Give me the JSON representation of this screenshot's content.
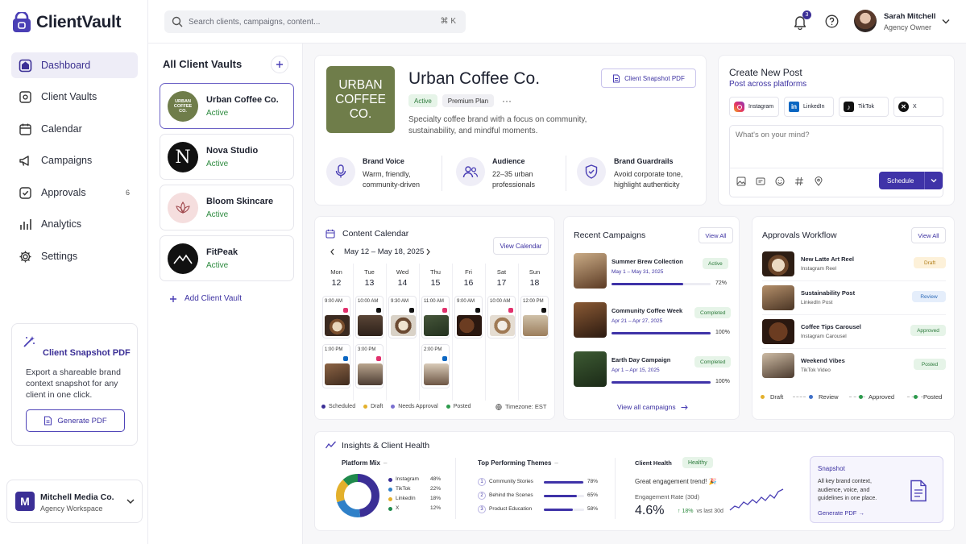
{
  "app": {
    "name": "ClientVault",
    "accent": "#4a3fb5"
  },
  "sidebar": {
    "items": [
      {
        "label": "Dashboard",
        "icon": "dashboard-icon"
      },
      {
        "label": "Client Vaults",
        "icon": "vault-icon"
      },
      {
        "label": "Calendar",
        "icon": "calendar-icon"
      },
      {
        "label": "Campaigns",
        "icon": "megaphone-icon"
      },
      {
        "label": "Approvals",
        "icon": "check-square-icon",
        "count": "6"
      },
      {
        "label": "Analytics",
        "icon": "bar-chart-icon"
      },
      {
        "label": "Settings",
        "icon": "gear-icon"
      }
    ],
    "snapshot_card": {
      "title": "Client Snapshot PDF",
      "description": "Export a shareable brand context snapshot for any client in one click.",
      "button": "Generate PDF"
    },
    "workspace": {
      "initial": "M",
      "name": "Mitchell Media Co.",
      "subtitle": "Agency Workspace"
    }
  },
  "topbar": {
    "search_placeholder": "Search clients, campaigns, content...",
    "shortcut": "⌘ K",
    "notification_count": "3",
    "user": {
      "name": "Sarah Mitchell",
      "role": "Agency Owner"
    }
  },
  "vaults": {
    "title": "All Client Vaults",
    "add_label": "Add Client Vault",
    "items": [
      {
        "name": "Urban Coffee Co.",
        "status": "Active",
        "logo_text": "URBAN COFFEE CO."
      },
      {
        "name": "Nova Studio",
        "status": "Active",
        "logo_text": "N"
      },
      {
        "name": "Bloom Skincare",
        "status": "Active"
      },
      {
        "name": "FitPeak",
        "status": "Active"
      }
    ]
  },
  "client": {
    "logo_lines": [
      "URBAN",
      "COFFEE",
      "CO."
    ],
    "name": "Urban Coffee Co.",
    "status": "Active",
    "plan": "Premium Plan",
    "more": "···",
    "snapshot_button": "Client Snapshot PDF",
    "description": "Specialty coffee brand with a focus on community, sustainability, and mindful moments.",
    "attributes": [
      {
        "title": "Brand Voice",
        "text": "Warm, friendly, community-driven",
        "icon": "microphone-icon"
      },
      {
        "title": "Audience",
        "text": "22–35 urban professionals",
        "icon": "users-icon"
      },
      {
        "title": "Brand Guardrails",
        "text": "Avoid corporate tone, highlight authenticity",
        "icon": "shield-icon"
      }
    ]
  },
  "create_post": {
    "title": "Create New Post",
    "subtitle": "Post across platforms",
    "platforms": [
      "Instagram",
      "LinkedIn",
      "TikTok",
      "X"
    ],
    "placeholder": "What's on your mind?",
    "schedule": "Schedule"
  },
  "calendar": {
    "title": "Content Calendar",
    "range": "May 12 – May 18, 2025",
    "view_button": "View Calendar",
    "days": [
      {
        "d": "Mon",
        "n": "12"
      },
      {
        "d": "Tue",
        "n": "13"
      },
      {
        "d": "Wed",
        "n": "14"
      },
      {
        "d": "Thu",
        "n": "15"
      },
      {
        "d": "Fri",
        "n": "16"
      },
      {
        "d": "Sat",
        "n": "17"
      },
      {
        "d": "Sun",
        "n": "18"
      }
    ],
    "posts_row1": [
      "9:00 AM",
      "10:00 AM",
      "9:30 AM",
      "11:00 AM",
      "9:00 AM",
      "10:00 AM",
      "12:00 PM"
    ],
    "posts_row2": [
      "1:00 PM",
      "3:00 PM",
      "2:00 PM"
    ],
    "legend": [
      "Scheduled",
      "Draft",
      "Needs Approval",
      "Posted"
    ],
    "timezone": "Timezone: EST"
  },
  "recent_campaigns": {
    "title": "Recent Campaigns",
    "view_all": "View All",
    "items": [
      {
        "name": "Summer Brew Collection",
        "dates": "May 1 – May 31, 2025",
        "status": "Active",
        "progress": 72,
        "progress_label": "72%"
      },
      {
        "name": "Community Coffee Week",
        "dates": "Apr 21 – Apr 27, 2025",
        "status": "Completed",
        "progress": 100,
        "progress_label": "100%"
      },
      {
        "name": "Earth Day Campaign",
        "dates": "Apr 1 – Apr 15, 2025",
        "status": "Completed",
        "progress": 100,
        "progress_label": "100%"
      }
    ],
    "footer_link": "View all campaigns"
  },
  "approvals": {
    "title": "Approvals Workflow",
    "view_all": "View All",
    "items": [
      {
        "name": "New Latte Art Reel",
        "type": "Instagram Reel",
        "status": "Draft"
      },
      {
        "name": "Sustainability Post",
        "type": "LinkedIn Post",
        "status": "Review"
      },
      {
        "name": "Coffee Tips Carousel",
        "type": "Instagram Carousel",
        "status": "Approved"
      },
      {
        "name": "Weekend Vibes",
        "type": "TikTok Video",
        "status": "Posted"
      }
    ],
    "steps": [
      "Draft",
      "Review",
      "Approved",
      "Posted"
    ]
  },
  "insights": {
    "title": "Insights & Client Health",
    "platform_mix": {
      "title": "Platform Mix",
      "items": [
        {
          "name": "Instagram",
          "value": 48,
          "label": "48%",
          "color": "#3b2f96"
        },
        {
          "name": "TikTok",
          "value": 22,
          "label": "22%",
          "color": "#2f80c8"
        },
        {
          "name": "LinkedIn",
          "value": 18,
          "label": "18%",
          "color": "#e3b02b"
        },
        {
          "name": "X",
          "value": 12,
          "label": "12%",
          "color": "#1f8a4c"
        }
      ]
    },
    "themes": {
      "title": "Top Performing Themes",
      "items": [
        {
          "rank": "1",
          "name": "Community Stories",
          "value": 78,
          "label": "78%"
        },
        {
          "rank": "2",
          "name": "Behind the Scenes",
          "value": 65,
          "label": "65%"
        },
        {
          "rank": "3",
          "name": "Product Education",
          "value": 58,
          "label": "58%"
        }
      ]
    },
    "health": {
      "title": "Client Health",
      "status": "Healthy",
      "trend": "Great engagement trend! 🎉",
      "metric_label": "Engagement Rate (30d)",
      "metric_value": "4.6%",
      "delta": "↑ 18%",
      "delta_note": "vs last 30d"
    },
    "snapshot": {
      "title": "Snapshot",
      "text": "All key brand context, audience, voice, and guidelines in one place.",
      "link": "Generate PDF →"
    }
  }
}
